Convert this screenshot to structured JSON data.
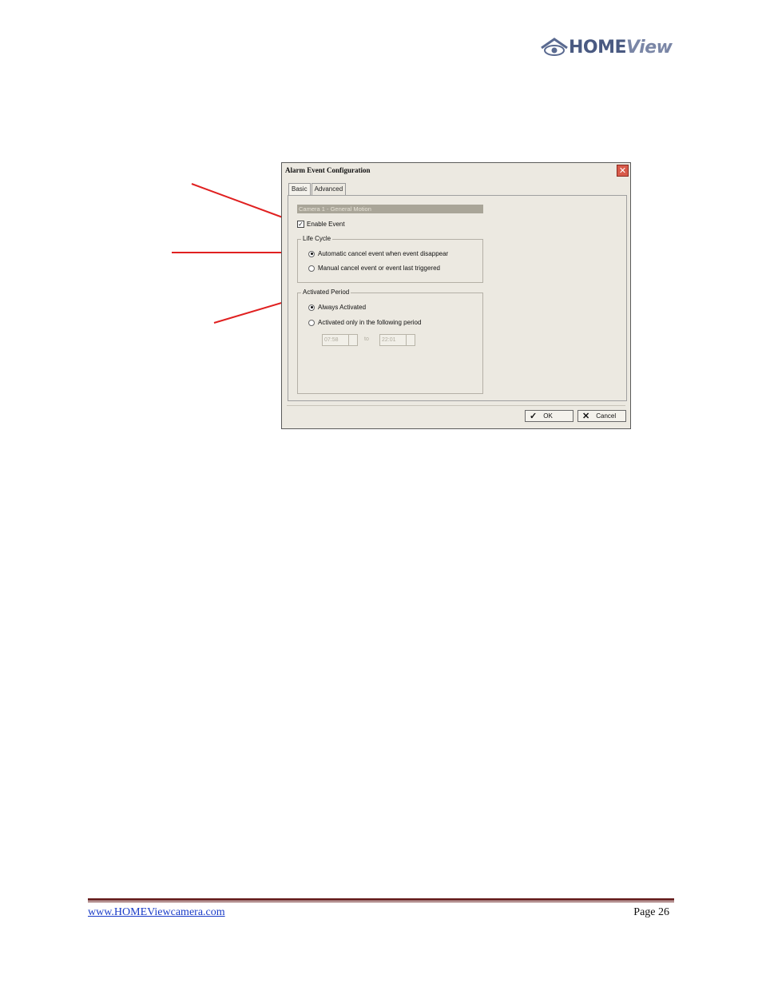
{
  "logo": {
    "brand_bold": "HOME",
    "brand_italic": "View"
  },
  "dialog": {
    "title": "Alarm Event Configuration",
    "close_glyph": "✕",
    "tabs": [
      {
        "label": "Basic"
      },
      {
        "label": "Advanced"
      }
    ],
    "section_label": "Camera 1 - General Motion",
    "enable_event": {
      "label": "Enable Event",
      "checked": true
    },
    "life_cycle": {
      "label": "Life Cycle",
      "options": [
        {
          "label": "Automatic cancel event when event disappear",
          "selected": true
        },
        {
          "label": "Manual cancel event or event last triggered",
          "selected": false
        }
      ]
    },
    "activated_period": {
      "label": "Activated Period",
      "options": [
        {
          "label": "Always Activated",
          "selected": true
        },
        {
          "label": "Activated only in the following period",
          "selected": false
        }
      ],
      "start_time": "07:58",
      "to_label": "to",
      "end_time": "22:01"
    },
    "ok_label": "OK",
    "cancel_label": "Cancel"
  },
  "footer": {
    "link": "www.HOMEViewcamera.com",
    "page": "Page 26"
  },
  "colors": {
    "arrow": "#e02020",
    "footer_rule": "#6b2424",
    "link": "#1a3cc8"
  }
}
